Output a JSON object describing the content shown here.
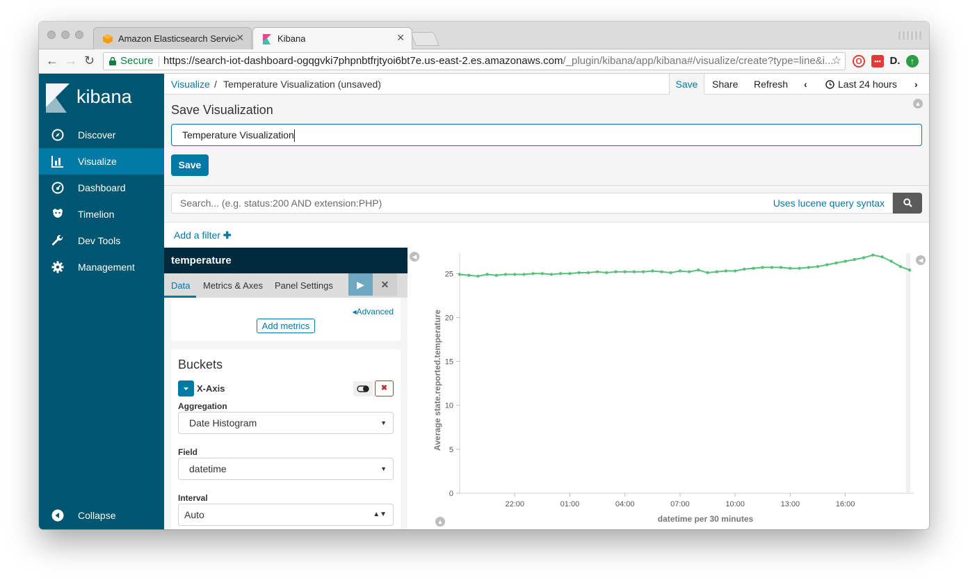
{
  "browser": {
    "tabs": [
      {
        "title": "Amazon Elasticsearch Service"
      },
      {
        "title": "Kibana"
      }
    ],
    "secure_label": "Secure",
    "url_main": "https://search-iot-dashboard-ogqgvki7phpnbtfrjtyoi6bt7e.us-east-2.es.amazonaws.com",
    "url_path": "/_plugin/kibana/app/kibana#/visualize/create?type=line&i...",
    "accent": "#0079a5"
  },
  "sidebar": {
    "brand": "kibana",
    "items": [
      {
        "label": "Discover",
        "icon": "compass-icon"
      },
      {
        "label": "Visualize",
        "icon": "bar-chart-icon"
      },
      {
        "label": "Dashboard",
        "icon": "gauge-icon"
      },
      {
        "label": "Timelion",
        "icon": "timelion-icon"
      },
      {
        "label": "Dev Tools",
        "icon": "wrench-icon"
      },
      {
        "label": "Management",
        "icon": "gear-icon"
      }
    ],
    "collapse": "Collapse",
    "bg_color": "#005571",
    "active_color": "#0079a5"
  },
  "topnav": {
    "breadcrumb_link": "Visualize",
    "breadcrumb_sep": "/",
    "breadcrumb_title": "Temperature Visualization (unsaved)",
    "save": "Save",
    "share": "Share",
    "refresh": "Refresh",
    "timerange": "Last 24 hours"
  },
  "save_panel": {
    "heading": "Save Visualization",
    "title_value": "Temperature Visualization",
    "save_button": "Save"
  },
  "query": {
    "placeholder": "Search... (e.g. status:200 AND extension:PHP)",
    "syntax_link": "Uses lucene query syntax"
  },
  "filter": {
    "add_filter": "Add a filter"
  },
  "editor": {
    "index_pattern": "temperature",
    "tabs": [
      "Data",
      "Metrics & Axes",
      "Panel Settings"
    ],
    "advanced": "Advanced",
    "add_metrics": "Add metrics",
    "buckets_title": "Buckets",
    "xaxis_label": "X-Axis",
    "aggregation_label": "Aggregation",
    "aggregation_value": "Date Histogram",
    "field_label": "Field",
    "field_value": "datetime",
    "interval_label": "Interval",
    "interval_value": "Auto"
  },
  "chart_data": {
    "type": "line",
    "title": "",
    "xlabel": "datetime per 30 minutes",
    "ylabel": "Average state.reported.temperature",
    "ylim": [
      0,
      27
    ],
    "yticks": [
      0,
      5,
      10,
      15,
      20,
      25
    ],
    "xtick_labels": [
      "22:00",
      "01:00",
      "04:00",
      "07:00",
      "10:00",
      "13:00",
      "16:00"
    ],
    "xtick_hours": [
      22,
      25,
      28,
      31,
      34,
      37,
      40
    ],
    "x_start_hour": 19.0,
    "x_end_hour": 43.5,
    "color": "#57c17b",
    "series": [
      {
        "x": [
          19.0,
          19.5,
          20.0,
          20.5,
          21.0,
          21.5,
          22.0,
          22.5,
          23.0,
          23.5,
          24.0,
          24.5,
          25.0,
          25.5,
          26.0,
          26.5,
          27.0,
          27.5,
          28.0,
          28.5,
          29.0,
          29.5,
          30.0,
          30.5,
          31.0,
          31.5,
          32.0,
          32.5,
          33.0,
          33.5,
          34.0,
          34.5,
          35.0,
          35.5,
          36.0,
          36.5,
          37.0,
          37.5,
          38.0,
          38.5,
          39.0,
          39.5,
          40.0,
          40.5,
          41.0,
          41.5,
          42.0,
          42.5,
          43.0,
          43.5
        ],
        "values": [
          24.9,
          24.8,
          24.7,
          24.9,
          24.8,
          24.9,
          24.9,
          24.9,
          25.0,
          25.0,
          24.9,
          25.0,
          25.0,
          25.1,
          25.1,
          25.2,
          25.1,
          25.2,
          25.2,
          25.2,
          25.2,
          25.3,
          25.2,
          25.1,
          25.3,
          25.2,
          25.4,
          25.1,
          25.2,
          25.3,
          25.3,
          25.5,
          25.6,
          25.7,
          25.7,
          25.7,
          25.6,
          25.6,
          25.7,
          25.8,
          26.0,
          26.2,
          26.4,
          26.6,
          26.8,
          27.1,
          26.9,
          26.4,
          25.8,
          25.4
        ]
      }
    ]
  }
}
